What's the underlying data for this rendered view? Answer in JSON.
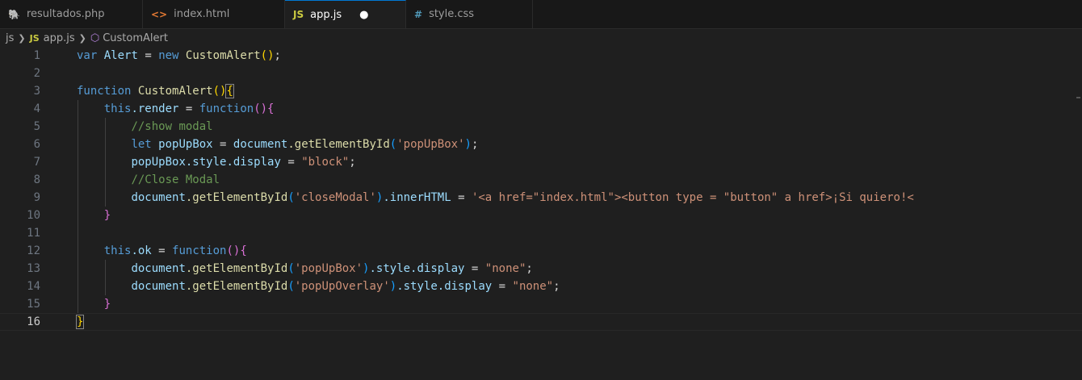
{
  "tabs": [
    {
      "icon": "php-elephant-icon",
      "glyph": "🐘",
      "label": "resultados.php",
      "active": false
    },
    {
      "icon": "html-brackets-icon",
      "glyph": "<>",
      "label": "index.html",
      "active": false
    },
    {
      "icon": "js-icon",
      "glyph": "JS",
      "label": "app.js",
      "active": true,
      "dirty": "●"
    },
    {
      "icon": "css-hash-icon",
      "glyph": "#",
      "label": "style.css",
      "active": false
    }
  ],
  "breadcrumb": {
    "folder": "js",
    "file_icon": "JS",
    "file": "app.js",
    "symbol_icon": "⬡",
    "symbol": "CustomAlert"
  },
  "line_numbers": [
    "1",
    "2",
    "3",
    "4",
    "5",
    "6",
    "7",
    "8",
    "9",
    "10",
    "11",
    "12",
    "13",
    "14",
    "15",
    "16"
  ],
  "current_line": "16",
  "code": {
    "l1": {
      "kw": "var",
      "name": "Alert",
      "eq": " = ",
      "kw2": "new",
      "fn": "CustomAlert",
      "paren": "()",
      "end": ";"
    },
    "l3": {
      "kw": "function",
      "fn": "CustomAlert",
      "paren": "()",
      "brace": "{"
    },
    "l4": {
      "kw": "this",
      "prop": ".render",
      "eq": " = ",
      "kw2": "function",
      "paren": "()",
      "brace": "{"
    },
    "l5": {
      "comment": "//show modal"
    },
    "l6": {
      "kw": "let",
      "name": "popUpBox",
      "eq": " = ",
      "obj": "document",
      "method": ".getElementById",
      "open": "(",
      "str": "'popUpBox'",
      "close": ")",
      "end": ";"
    },
    "l7": {
      "name": "popUpBox",
      "prop": ".style.display",
      "eq": " = ",
      "str": "\"block\"",
      "end": ";"
    },
    "l8": {
      "comment": "//Close Modal"
    },
    "l9": {
      "obj": "document",
      "method": ".getElementById",
      "open": "(",
      "str": "'closeModal'",
      "close": ")",
      "prop": ".innerHTML",
      "eq": " = ",
      "str2": "'<a href=\"index.html\"><button type = \"button\" a href>¡Si quiero!<"
    },
    "l10": {
      "brace": "}"
    },
    "l12": {
      "kw": "this",
      "prop": ".ok",
      "eq": " = ",
      "kw2": "function",
      "paren": "()",
      "brace": "{"
    },
    "l13": {
      "obj": "document",
      "method": ".getElementById",
      "open": "(",
      "str": "'popUpBox'",
      "close": ")",
      "prop": ".style.display",
      "eq": " = ",
      "str2": "\"none\"",
      "end": ";"
    },
    "l14": {
      "obj": "document",
      "method": ".getElementById",
      "open": "(",
      "str": "'popUpOverlay'",
      "close": ")",
      "prop": ".style.display",
      "eq": " = ",
      "str2": "\"none\"",
      "end": ";"
    },
    "l15": {
      "brace": "}"
    },
    "l16": {
      "brace": "}"
    }
  }
}
